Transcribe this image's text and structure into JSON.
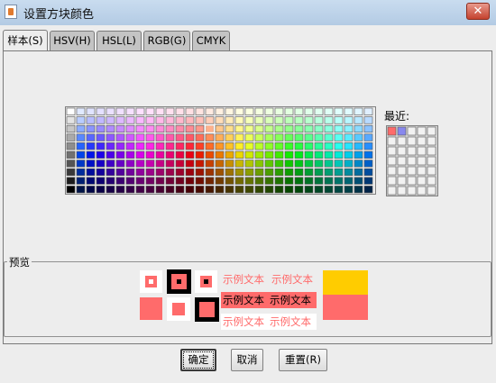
{
  "window": {
    "title": "设置方块颜色",
    "close_glyph": "✕"
  },
  "tabs": [
    {
      "label": "样本(S)",
      "active": true
    },
    {
      "label": "HSV(H)",
      "active": false
    },
    {
      "label": "HSL(L)",
      "active": false
    },
    {
      "label": "RGB(G)",
      "active": false
    },
    {
      "label": "CMYK",
      "active": false
    }
  ],
  "swatches": {
    "rows": 10,
    "cols": 31,
    "selected": {
      "row": 2,
      "col": 14
    }
  },
  "recent": {
    "label": "最近:",
    "rows": 7,
    "cols": 5,
    "colors": [
      "#ff6b6b",
      "#8888ee"
    ]
  },
  "preview": {
    "label": "预览",
    "sample_text": "示例文本",
    "accent": "#ff6b6b",
    "yellow": "#ffcc00"
  },
  "buttons": {
    "ok": "确定",
    "cancel": "取消",
    "reset": "重置(R)"
  }
}
